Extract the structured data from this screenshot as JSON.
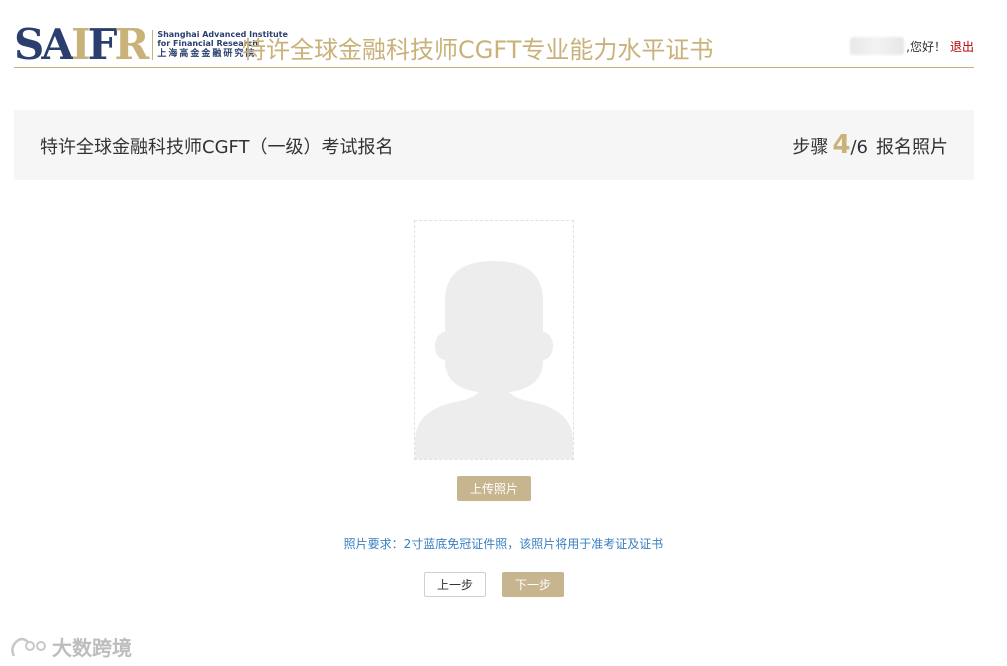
{
  "header": {
    "logo_mark": "SAIFR",
    "logo_en_line1": "Shanghai Advanced Institute",
    "logo_en_line2": "for Financial Research",
    "logo_cn": "上海高金金融研究院",
    "site_title": "特许全球金融科技师CGFT专业能力水平证书",
    "greeting": ",您好！",
    "logout": "退出"
  },
  "stepbar": {
    "title": "特许全球金融科技师CGFT（一级）考试报名",
    "step_prefix": "步骤",
    "step_current": "4",
    "step_total": "/6",
    "step_name": "报名照片"
  },
  "photo": {
    "upload_label": "上传照片",
    "requirement": "照片要求：2寸蓝底免冠证件照，该照片将用于准考证及证书"
  },
  "nav": {
    "prev_label": "上一步",
    "next_label": "下一步"
  },
  "watermark": {
    "text": "大数跨境"
  },
  "colors": {
    "brand_gold": "#c9b27a",
    "button_gold": "#c6b58f",
    "brand_navy": "#2b3f6e",
    "logout_red": "#b30000",
    "link_blue": "#3a7fc1"
  }
}
